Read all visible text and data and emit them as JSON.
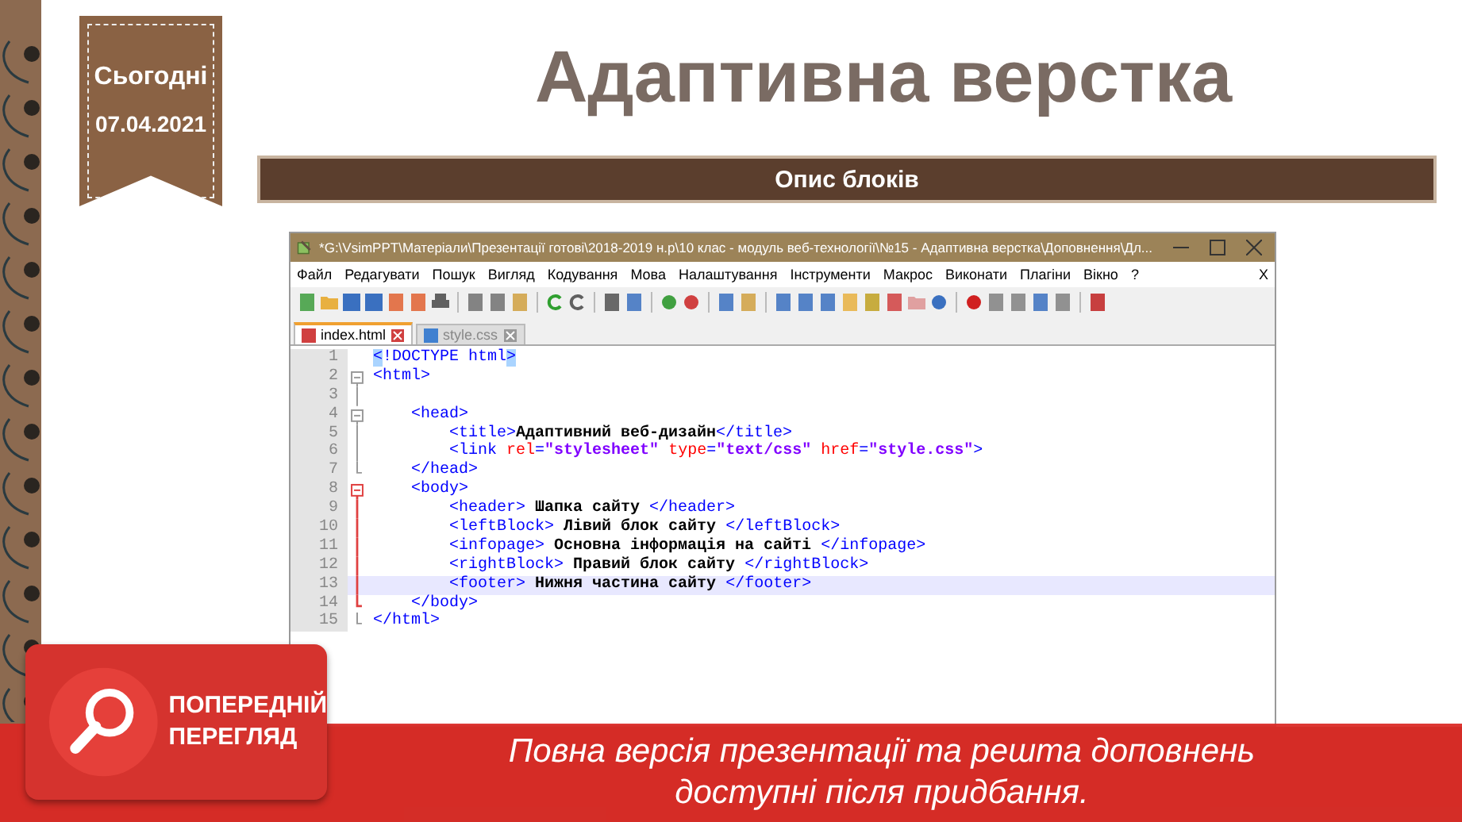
{
  "date_ribbon": {
    "label": "Сьогодні",
    "date": "07.04.2021"
  },
  "title": "Адаптивна верстка",
  "section_bar": "Опис блоків",
  "editor": {
    "title": "*G:\\VsimPPT\\Матеріали\\Презентації готові\\2018-2019 н.р\\10 клас - модуль веб-технології\\№15 - Адаптивна верстка\\Доповнення\\Дл...",
    "menu": [
      "Файл",
      "Редагувати",
      "Пошук",
      "Вигляд",
      "Кодування",
      "Мова",
      "Налаштування",
      "Інструменти",
      "Макрос",
      "Виконати",
      "Плагіни",
      "Вікно",
      "?"
    ],
    "menu_close": "X",
    "tabs": [
      {
        "label": "index.html",
        "selected": true
      },
      {
        "label": "style.css",
        "selected": false
      }
    ],
    "lines": [
      {
        "num": "1",
        "kind": "plain",
        "selected": false,
        "tokens": [
          {
            "kind": "match",
            "text": "<"
          },
          {
            "kind": "tag",
            "text": "!DOCTYPE html"
          },
          {
            "kind": "match",
            "text": ">"
          }
        ]
      },
      {
        "num": "2",
        "kind": "fold-open",
        "active": false,
        "selected": false,
        "tokens": [
          {
            "kind": "tag",
            "text": "<html>"
          }
        ]
      },
      {
        "num": "3",
        "kind": "fold-line",
        "active": false,
        "selected": false
      },
      {
        "num": "4",
        "kind": "fold-open",
        "active": false,
        "selected": false,
        "tokens": [
          {
            "kind": "tag",
            "text": "    <head>"
          }
        ]
      },
      {
        "num": "5",
        "kind": "fold-line",
        "active": false,
        "selected": false,
        "tokens": [
          {
            "kind": "tag",
            "text": "        <title>"
          },
          {
            "kind": "text",
            "text": "Адаптивний веб-дизайн"
          },
          {
            "kind": "tag",
            "text": "</title>"
          }
        ]
      },
      {
        "num": "6",
        "kind": "fold-line",
        "active": false,
        "selected": false,
        "tokens": [
          {
            "kind": "tag",
            "text": "        <link "
          },
          {
            "kind": "attr",
            "text": "rel"
          },
          {
            "kind": "tag",
            "text": "="
          },
          {
            "kind": "string",
            "text": "\"stylesheet\" "
          },
          {
            "kind": "attr",
            "text": "type"
          },
          {
            "kind": "tag",
            "text": "="
          },
          {
            "kind": "string",
            "text": "\"text/css\" "
          },
          {
            "kind": "attr",
            "text": "href"
          },
          {
            "kind": "tag",
            "text": "="
          },
          {
            "kind": "string",
            "text": "\"style.css\""
          },
          {
            "kind": "tag",
            "text": ">"
          }
        ]
      },
      {
        "num": "7",
        "kind": "fold-end",
        "active": false,
        "selected": false,
        "tokens": [
          {
            "kind": "tag",
            "text": "    </head>"
          }
        ]
      },
      {
        "num": "8",
        "kind": "fold-open",
        "active": true,
        "selected": false,
        "tokens": [
          {
            "kind": "tag",
            "text": "    <body>"
          }
        ]
      },
      {
        "num": "9",
        "kind": "fold-line",
        "active": true,
        "selected": false,
        "tokens": [
          {
            "kind": "tag",
            "text": "        <header> "
          },
          {
            "kind": "text",
            "text": "Шапка сайту "
          },
          {
            "kind": "tag",
            "text": "</header>"
          }
        ]
      },
      {
        "num": "10",
        "kind": "fold-line",
        "active": true,
        "selected": false,
        "tokens": [
          {
            "kind": "tag",
            "text": "        <leftBlock> "
          },
          {
            "kind": "text",
            "text": "Лівий блок сайту "
          },
          {
            "kind": "tag",
            "text": "</leftBlock>"
          }
        ]
      },
      {
        "num": "11",
        "kind": "fold-line",
        "active": true,
        "selected": false,
        "tokens": [
          {
            "kind": "tag",
            "text": "        <infopage> "
          },
          {
            "kind": "text",
            "text": "Основна інформація на сайті "
          },
          {
            "kind": "tag",
            "text": "</infopage>"
          }
        ]
      },
      {
        "num": "12",
        "kind": "fold-line",
        "active": true,
        "selected": false,
        "tokens": [
          {
            "kind": "tag",
            "text": "        <rightBlock> "
          },
          {
            "kind": "text",
            "text": "Правий блок сайту "
          },
          {
            "kind": "tag",
            "text": "</rightBlock>"
          }
        ]
      },
      {
        "num": "13",
        "kind": "fold-line",
        "active": true,
        "selected": true,
        "tokens": [
          {
            "kind": "tag",
            "text": "        <footer> "
          },
          {
            "kind": "text",
            "text": "Нижня частина сайту "
          },
          {
            "kind": "tag",
            "text": "</footer>"
          }
        ]
      },
      {
        "num": "14",
        "kind": "fold-end",
        "active": true,
        "selected": false,
        "tokens": [
          {
            "kind": "tag",
            "text": "    </body>"
          }
        ]
      },
      {
        "num": "15",
        "kind": "fold-end",
        "active": false,
        "selected": false,
        "tokens": [
          {
            "kind": "tag",
            "text": "</html>"
          }
        ]
      }
    ]
  },
  "preview_badge": {
    "lines": [
      "ПОПЕРЕДНІЙ",
      "ПЕРЕГЛЯД"
    ]
  },
  "banner_text": "Повна версія презентації та решта доповнень доступні після придбання."
}
